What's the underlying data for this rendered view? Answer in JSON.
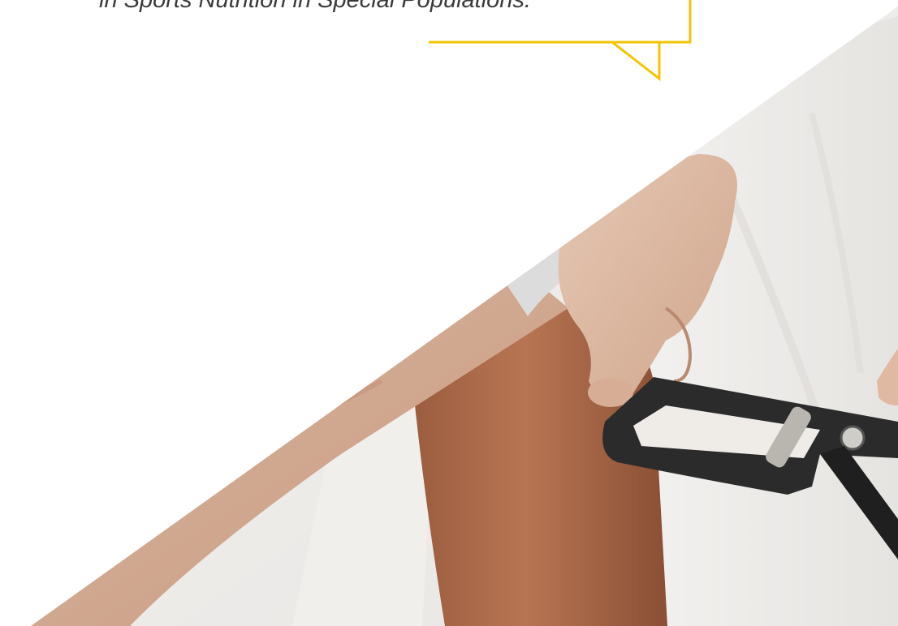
{
  "quote": {
    "text": "in Sports Nutrition in Special Populations."
  },
  "colors": {
    "accent": "#F2C500",
    "quote_text": "#3A3A3A",
    "background": "#FFFFFF"
  },
  "image": {
    "subject": "skinfold caliper measurement on upper arm"
  }
}
